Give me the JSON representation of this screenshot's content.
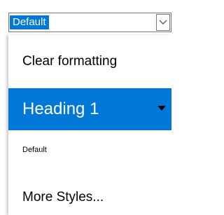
{
  "combo": {
    "value": "Default",
    "button_icon": "chevron-down-icon"
  },
  "dropdown": {
    "items": [
      {
        "label": "Clear formatting",
        "selected": false
      },
      {
        "label": "Heading 1",
        "selected": true,
        "submenu_icon": "triangle-down-icon"
      },
      {
        "label": "Default",
        "selected": false
      },
      {
        "label": "More Styles...",
        "selected": false
      }
    ]
  },
  "colors": {
    "accent": "#0078d7",
    "text": "#000000",
    "selected_text": "#ffffff",
    "border": "#7a7a7a"
  }
}
